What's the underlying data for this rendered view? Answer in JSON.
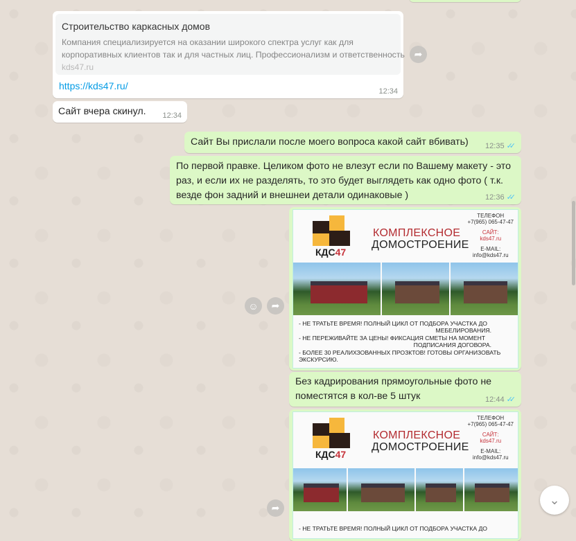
{
  "messages": {
    "link": {
      "preview_title": "Строительство каркасных домов",
      "preview_desc_1": "Компания специализируется на оказании широкого спектра услуг как для",
      "preview_desc_2": "корпоративных клиентов так и для частных лиц. Профессионализм и ответственность",
      "preview_domain": "kds47.ru",
      "url": "https://kds47.ru/",
      "time": "12:34"
    },
    "m2": {
      "text": "Сайт вчера скинул.",
      "time": "12:34"
    },
    "m3": {
      "text": "Сайт Вы прислали после моего вопроса какой сайт вбивать)",
      "time": "12:35"
    },
    "m4": {
      "line1": "По первой правке. Целиком фото не влезут если по Вашему макету - это",
      "line2": "раз, и если их не разделять, то это будет выглядеть как одно фото ( т.к.",
      "line3": "везде фон задний и внешнеи детали одинаковые )",
      "time": "12:36"
    },
    "m5": {
      "line1": "Без кадрирования прямоугольные фото не",
      "line2": "поместятся в кол-ве 5 штук",
      "time": "12:44"
    }
  },
  "poster": {
    "brand": "КДС",
    "brand_num": "47",
    "headline_1": "КОМПЛЕКСНОЕ",
    "headline_2": "ДОМОСТРОЕНИЕ",
    "phone_label": "ТЕЛЕФОН",
    "phone": "+7(965) 065-47-47",
    "site_label": "САЙТ:",
    "site": "kds47.ru",
    "email_label": "E-MAIL:",
    "email": "info@kds47.ru",
    "b1a": "- Не тратьте время! Полный цикл от подбора участка до",
    "b1b": "мебелирования.",
    "b2a": "- Не переживайте за цены! Фиксация сметы на момент",
    "b2b": "подписания договора.",
    "b3a": "- Более 30 реалихзованных прозктов! Готовы организовать",
    "b3b": "экскурсию."
  },
  "ticks": "✓✓",
  "colors": {
    "outgoing": "#dcf8c6",
    "incoming": "#ffffff",
    "link": "#039be5",
    "read_tick": "#4fc3f7"
  }
}
